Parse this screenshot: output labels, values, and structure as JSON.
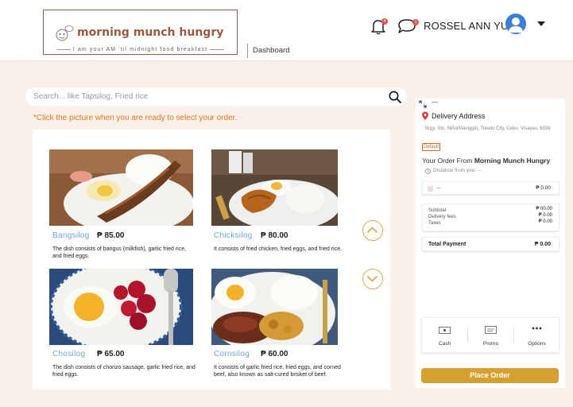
{
  "header": {
    "logo_title": "morning munch hungry",
    "logo_tagline": "I am your AM 'til midnight food breakfast",
    "nav_dashboard": "Dashboard",
    "notification_count": "4",
    "message_count": "1",
    "user_name": "ROSSEL ANN YU"
  },
  "search": {
    "placeholder": "Search... like Tapsilog, Fried rice"
  },
  "instruction": "*Click the picture when you are ready to select your order.",
  "menu": [
    {
      "name": "Bangsilog",
      "price": "₱ 85.00",
      "desc": "The dish consists of bangus (milkfish), garlic fried rice, and fried eggs."
    },
    {
      "name": "Chicksilog",
      "price": "₱ 80.00",
      "desc": "It consists of fried chicken, fried eggs, and fried rice."
    },
    {
      "name": "Chosilog",
      "price": "₱ 65.00",
      "desc": "The dish consists of chorizo sausage, garlic fried rice, and fried eggs."
    },
    {
      "name": "Cornsilog",
      "price": "₱ 60.00",
      "desc": "It consists of garlic fried rice, fried eggs, and corned beef, also known as salt-cured brisket of beef."
    }
  ],
  "order": {
    "expand_icon": "expand-icon",
    "menu_dash": "—",
    "delivery_title": "Delivery Address",
    "address": "Brgy. Sto. Niño(Mainggit), Toledo City, Cebu, Visayas, 6038",
    "default_badge": "Default",
    "your_order_prefix": "Your Order From",
    "store_name": "Morning Munch Hungry",
    "distance": "Distance from you: --",
    "item_name": "--",
    "item_price": "₱ 0.00",
    "subtotal_label": "Subtotal",
    "subtotal_value": "₱ 00.00",
    "delivery_label": "Delivery fees",
    "delivery_value": "₱ 0.00",
    "taxes_label": "Taxes",
    "taxes_value": "₱ 0.00",
    "total_label": "Total Payment",
    "total_value": "₱ 0.00",
    "pay_cash": "Cash",
    "pay_promo": "Promo",
    "pay_options": "Options",
    "place_order": "Place Order"
  },
  "colors": {
    "accent": "#d6a031",
    "brand": "#9a5a3d",
    "link": "#6fa4d6",
    "instruction": "#d8791c",
    "background": "#faf0e9"
  }
}
